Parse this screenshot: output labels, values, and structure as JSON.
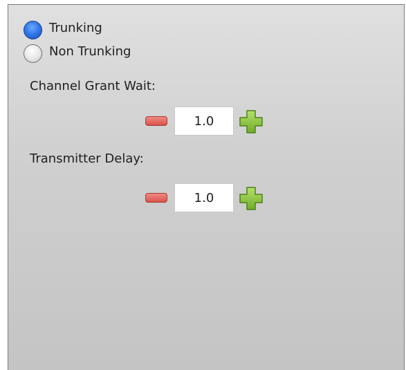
{
  "mode": {
    "options": [
      {
        "label": "Trunking",
        "selected": true
      },
      {
        "label": "Non Trunking",
        "selected": false
      }
    ]
  },
  "channel_grant_wait": {
    "label": "Channel Grant Wait:",
    "value": "1.0"
  },
  "transmitter_delay": {
    "label": "Transmitter Delay:",
    "value": "1.0"
  },
  "colors": {
    "radio_selected": "#2f74e8",
    "minus_button": "#d9534b",
    "plus_button": "#8cc63f"
  },
  "icons": {
    "decrement": "minus-icon",
    "increment": "plus-icon"
  }
}
